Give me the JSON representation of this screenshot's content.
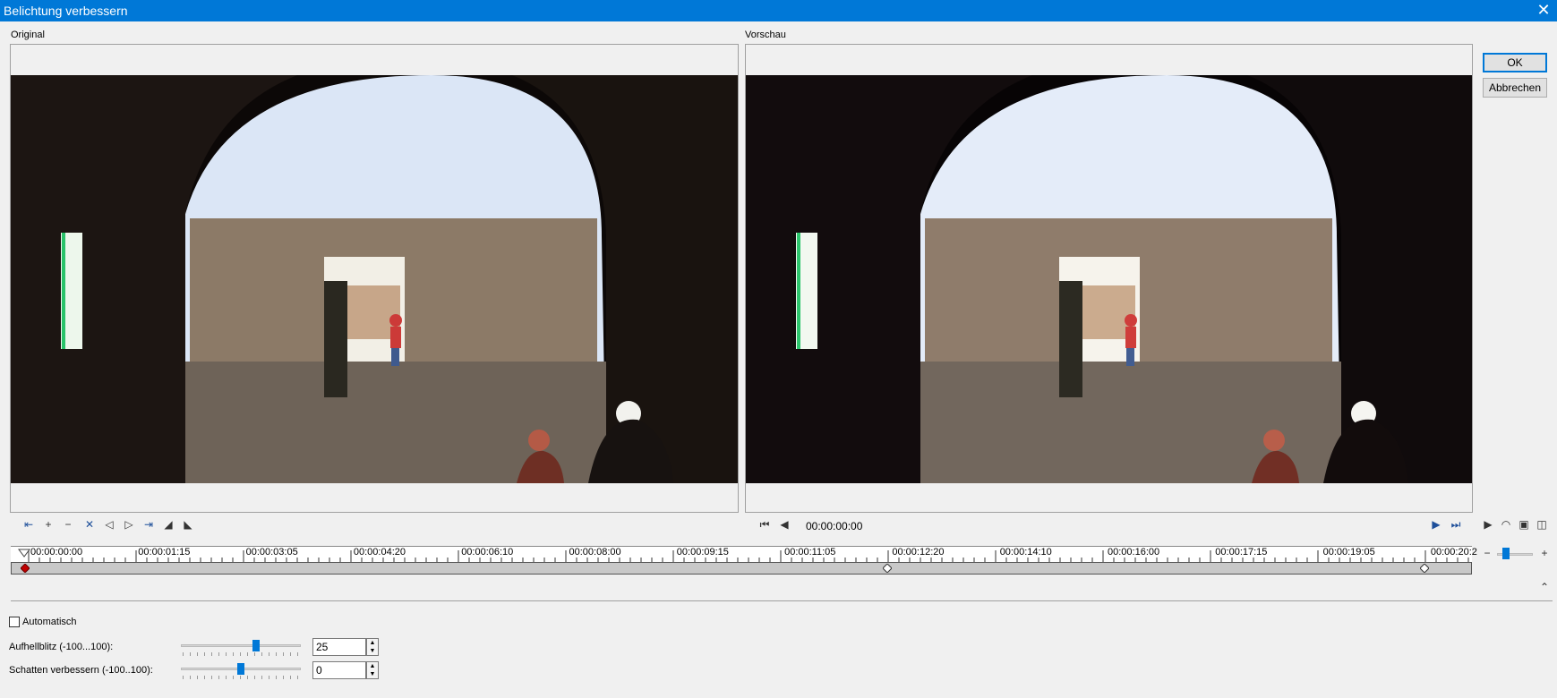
{
  "window": {
    "title": "Belichtung verbessern",
    "close_glyph": "✕"
  },
  "original": {
    "label": "Original"
  },
  "preview": {
    "label": "Vorschau",
    "timecode": "00:00:00:00"
  },
  "buttons": {
    "ok": "OK",
    "cancel": "Abbrechen"
  },
  "timeline": {
    "ticks": [
      "00:00:00:00",
      "00:00:01:15",
      "00:00:03:05",
      "00:00:04:20",
      "00:00:06:10",
      "00:00:08:00",
      "00:00:09:15",
      "00:00:11:05",
      "00:00:12:20",
      "00:00:14:10",
      "00:00:16:00",
      "00:00:17:15",
      "00:00:19:05",
      "00:00:20:2"
    ]
  },
  "options": {
    "auto_label": "Automatisch",
    "auto_checked": false,
    "fill_flash": {
      "label": "Aufhellblitz (-100...100):",
      "value": "25",
      "level": 25
    },
    "shadows": {
      "label": "Schatten verbessern (-100..100):",
      "value": "0",
      "level": 0
    }
  },
  "colors": {
    "titlebar": "#0078d7",
    "accent": "#0078d7",
    "keyframe_active": "#c00000"
  }
}
